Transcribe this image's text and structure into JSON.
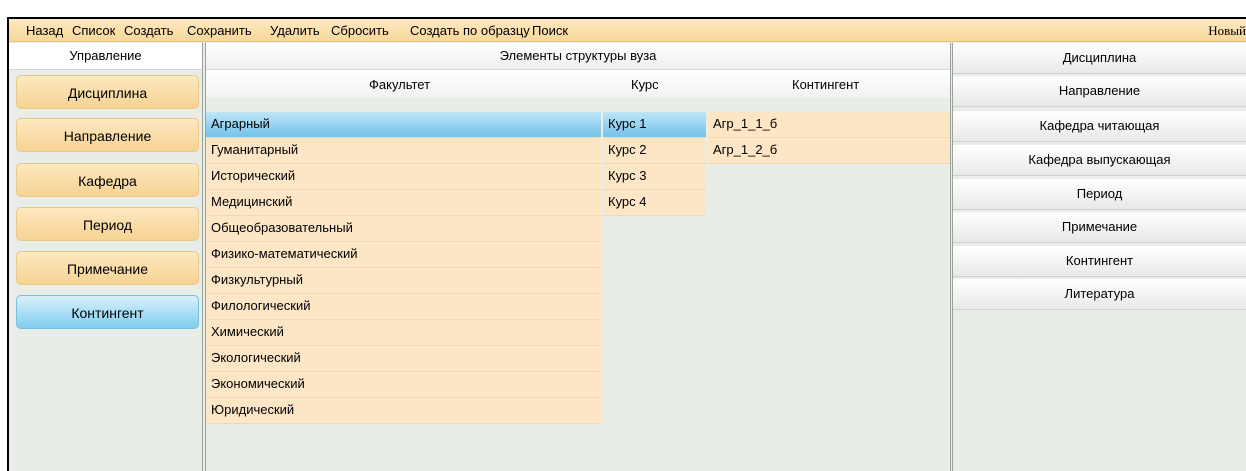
{
  "menubar": {
    "items": [
      "Назад",
      "Список",
      "Создать",
      "Сохранить",
      "Удалить",
      "Сбросить",
      "Создать по образцу",
      "Поиск"
    ],
    "new_label": "Новый"
  },
  "left": {
    "header": "Управление",
    "buttons": [
      "Дисциплина",
      "Направление",
      "Кафедра",
      "Период",
      "Примечание",
      "Контингент"
    ],
    "active": "Контингент"
  },
  "middle": {
    "header": "Элементы структуры вуза",
    "columns": {
      "faculty": "Факультет",
      "course": "Курс",
      "contingent": "Контингент"
    },
    "faculties": [
      "Аграрный",
      "Гуманитарный",
      "Исторический",
      "Медицинский",
      "Общеобразовательный",
      "Физико-математический",
      "Физкультурный",
      "Филологический",
      "Химический",
      "Экологический",
      "Экономический",
      "Юридический"
    ],
    "selected_faculty": "Аграрный",
    "courses": [
      "Курс 1",
      "Курс 2",
      "Курс 3",
      "Курс 4"
    ],
    "selected_course": "Курс 1",
    "contingents": [
      "Агр_1_1_б",
      "Агр_1_2_б"
    ]
  },
  "right": {
    "buttons": [
      "Дисциплина",
      "Направление",
      "Кафедра читающая",
      "Кафедра выпускающая",
      "Период",
      "Примечание",
      "Контингент",
      "Литература"
    ]
  },
  "colors": {
    "menubar": "#f7d79a",
    "button_orange": "#f6d394",
    "button_active_blue": "#7fcdf0",
    "row_fill": "#fde6c6",
    "background": "#e8ede8"
  }
}
